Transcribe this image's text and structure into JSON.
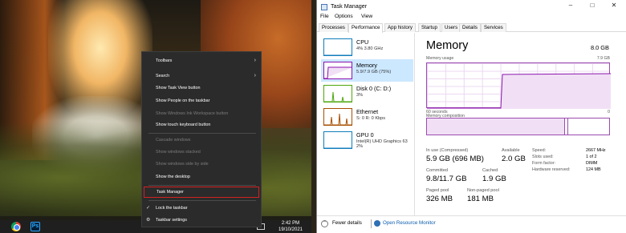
{
  "taskbar": {
    "ps_icon_text": "Ps",
    "time": "2:42 PM",
    "date": "19/10/2021"
  },
  "context_menu": {
    "items": [
      {
        "label": "Toolbars",
        "submenu": true,
        "disabled": false
      },
      {
        "label": "Search",
        "submenu": true,
        "disabled": false
      },
      {
        "label": "Show Task View button",
        "disabled": false
      },
      {
        "label": "Show People on the taskbar",
        "disabled": false
      },
      {
        "label": "Show Windows Ink Workspace button",
        "disabled": true
      },
      {
        "label": "Show touch keyboard button",
        "disabled": false
      },
      {
        "label": "Cascade windows",
        "disabled": true
      },
      {
        "label": "Show windows stacked",
        "disabled": true
      },
      {
        "label": "Show windows side by side",
        "disabled": true
      },
      {
        "label": "Show the desktop",
        "disabled": false
      },
      {
        "label": "Task Manager",
        "disabled": false,
        "highlighted": true
      },
      {
        "label": "Lock the taskbar",
        "disabled": false,
        "checked": true
      },
      {
        "label": "Taskbar settings",
        "disabled": false,
        "icon": "gear-icon"
      }
    ],
    "highlight_color": "#d32222"
  },
  "task_manager": {
    "title": "Task Manager",
    "menu": [
      "File",
      "Options",
      "View"
    ],
    "tabs": [
      "Processes",
      "Performance",
      "App history",
      "Startup",
      "Users",
      "Details",
      "Services"
    ],
    "active_tab": "Performance",
    "resources": [
      {
        "name": "CPU",
        "sub": "4%  3.80 GHz",
        "color": "#117dbb"
      },
      {
        "name": "Memory",
        "sub": "5.9/7.9 GB (75%)",
        "color": "#8b12ae",
        "selected": true
      },
      {
        "name": "Disk 0 (C: D:)",
        "sub": "3%",
        "color": "#4da60c"
      },
      {
        "name": "Ethernet",
        "sub": "S: 0  R: 0 Kbps",
        "color": "#a74f01"
      },
      {
        "name": "GPU 0",
        "sub": "Intel(R) UHD Graphics 63",
        "sub2": "2%",
        "color": "#117dbb"
      }
    ],
    "detail": {
      "title": "Memory",
      "total": "8.0 GB",
      "usage_label": "Memory usage",
      "usage_max": "7.9 GB",
      "seconds_label": "60 seconds",
      "zero_label": "0",
      "composition_label": "Memory composition",
      "in_use_fraction": 0.75,
      "stats": {
        "in_use_label": "In use (Compressed)",
        "in_use_value": "5.9 GB (696 MB)",
        "available_label": "Available",
        "available_value": "2.0 GB",
        "committed_label": "Committed",
        "committed_value": "9.8/11.7 GB",
        "cached_label": "Cached",
        "cached_value": "1.9 GB",
        "paged_label": "Paged pool",
        "paged_value": "326 MB",
        "nonpaged_label": "Non-paged pool",
        "nonpaged_value": "181 MB"
      },
      "kv": [
        {
          "key": "Speed:",
          "value": "2667 MHz"
        },
        {
          "key": "Slots used:",
          "value": "1 of 2"
        },
        {
          "key": "Form factor:",
          "value": "DIMM"
        },
        {
          "key": "Hardware reserved:",
          "value": "124 MB"
        }
      ]
    },
    "footer": {
      "fewer_details": "Fewer details",
      "open_resource_monitor": "Open Resource Monitor"
    }
  }
}
